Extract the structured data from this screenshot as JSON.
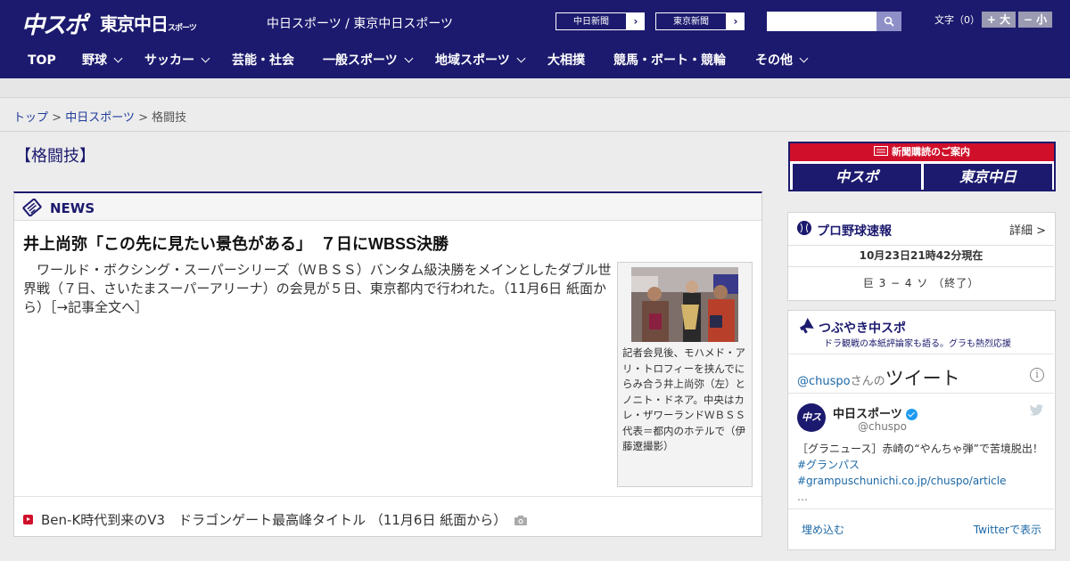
{
  "header": {
    "logo_chuspo": "中スポ",
    "logo_tokyo_main": "東京中日",
    "logo_tokyo_small": "スポーツ",
    "site_title": "中日スポーツ / 東京中日スポーツ",
    "paper_links": [
      {
        "label": "中日新聞",
        "arrow": "›"
      },
      {
        "label": "東京新聞",
        "arrow": "›"
      }
    ],
    "search": {
      "placeholder": "",
      "icon": "search-icon"
    },
    "font_size_label": "文字（0）",
    "font_bigger": "+ 大",
    "font_smaller": "− 小"
  },
  "nav": {
    "items": [
      {
        "label": "TOP",
        "has_dropdown": false
      },
      {
        "label": "野球",
        "has_dropdown": true
      },
      {
        "label": "サッカー",
        "has_dropdown": true
      },
      {
        "label": "芸能・社会",
        "has_dropdown": false
      },
      {
        "label": "一般スポーツ",
        "has_dropdown": true
      },
      {
        "label": "地域スポーツ",
        "has_dropdown": true
      },
      {
        "label": "大相撲",
        "has_dropdown": false
      },
      {
        "label": "競馬・ボート・競輪",
        "has_dropdown": false
      },
      {
        "label": "その他",
        "has_dropdown": true
      }
    ]
  },
  "breadcrumb": {
    "items": [
      "トップ",
      "中日スポーツ",
      "格闘技"
    ],
    "separator": ">"
  },
  "page": {
    "title": "【格闘技】"
  },
  "news": {
    "section_label": "NEWS",
    "headline": "井上尚弥「この先に見たい景色がある」　７日にWBSS決勝",
    "body": "　ワールド・ボクシング・スーパーシリーズ（ＷＢＳＳ）バンタム級決勝をメインとしたダブル世界戦（７日、さいたまスーパーアリーナ）の会見が５日、東京都内で行われた。（11月6日 紙面から）［→記事全文へ］",
    "photo_caption": "記者会見後、モハメド・アリ・トロフィーを挟んでにらみ合う井上尚弥（左）とノニト・ドネア。中央はカレ・ザワーランドＷＢＳＳ代表＝都内のホテルで（伊藤遼撮影）",
    "related": [
      {
        "title": "Ben-K時代到来のV3　ドラゴンゲート最高峰タイトル （11月6日 紙面から）",
        "has_photo": true
      }
    ]
  },
  "sidebar": {
    "subscription": {
      "header": "新聞購読のご案内",
      "logo_left": "中スポ",
      "logo_right": "東京中日"
    },
    "baseball": {
      "title": "プロ野球速報",
      "detail_link": "詳細 >",
      "timestamp": "10月23日21時42分現在",
      "score": "巨 3 − 4 ソ （終了）"
    },
    "twitter": {
      "title": "つぶやき中スポ",
      "subtitle": "ドラ観戦の本紙評論家も語る。グラも熱烈応援",
      "handle": "@chuspo",
      "handle_suffix": "さんの",
      "tweets_label": "ツイート",
      "account_name": "中日スポーツ",
      "account_user": "@chuspo",
      "tweet_prefix": "［グラニュース］赤崎の“やんちゃ弾”で苦境脱出！",
      "tweet_tag": "#グランパス",
      "tweet_link": "#grampuschunichi.co.jp/chuspo/article",
      "tweet_more": "…",
      "embed_label": "埋め込む",
      "view_on_twitter": "Twitterで表示"
    }
  }
}
